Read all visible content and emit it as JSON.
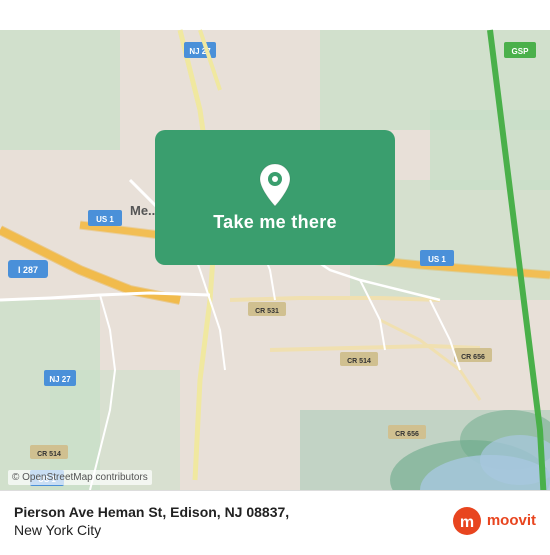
{
  "map": {
    "alt": "Map of Edison, NJ area",
    "osm_attribution": "© OpenStreetMap contributors"
  },
  "button": {
    "label": "Take me there"
  },
  "bottom_bar": {
    "address_line1": "Pierson Ave Heman St, Edison, NJ 08837,",
    "address_line2": "New York City"
  },
  "moovit": {
    "label": "moovit"
  }
}
